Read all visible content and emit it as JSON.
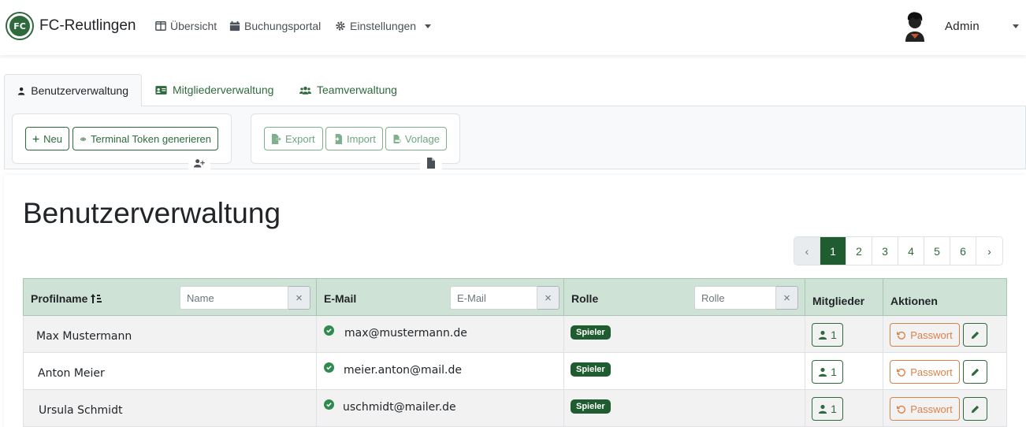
{
  "navbar": {
    "logo_text": "FC",
    "brand": "FC-Reutlingen",
    "links": [
      {
        "label": "Übersicht",
        "icon": "columns-icon"
      },
      {
        "label": "Buchungsportal",
        "icon": "calendar-icon"
      },
      {
        "label": "Einstellungen",
        "icon": "gear-icon"
      }
    ],
    "user": "Admin"
  },
  "tabs": [
    {
      "label": "Benutzerverwaltung",
      "icon": "user-icon",
      "active": true
    },
    {
      "label": "Mitgliederverwaltung",
      "icon": "id-card-icon"
    },
    {
      "label": "Teamverwaltung",
      "icon": "users-icon"
    }
  ],
  "toolbar": {
    "new_label": "Neu",
    "token_label": "Terminal Token generieren",
    "export_label": "Export",
    "import_label": "Import",
    "template_label": "Vorlage"
  },
  "page_title": "Benutzerverwaltung",
  "pagination": {
    "prev": "‹",
    "pages": [
      "1",
      "2",
      "3",
      "4",
      "5",
      "6"
    ],
    "active": "1",
    "next": "›"
  },
  "table": {
    "columns": {
      "profile": "Profilname",
      "email": "E-Mail",
      "role": "Rolle",
      "members": "Mitglieder",
      "actions": "Aktionen"
    },
    "filters": {
      "name_placeholder": "Name",
      "email_placeholder": "E-Mail",
      "role_placeholder": "Rolle",
      "clear": "×"
    },
    "password_label": "Passwort",
    "rows": [
      {
        "name": "Max Mustermann",
        "email": "max@mustermann.de",
        "role": "Spieler",
        "members": "1"
      },
      {
        "name": "Anton Meier",
        "email": "meier.anton@mail.de",
        "role": "Spieler",
        "members": "1"
      },
      {
        "name": "Ursula Schmidt",
        "email": "uschmidt@mailer.de",
        "role": "Spieler",
        "members": "1"
      }
    ]
  },
  "colors": {
    "primary": "#2f6a3d",
    "active": "#1f5c2f",
    "header_bg": "#cfe2d6",
    "warning": "#d9824a"
  }
}
